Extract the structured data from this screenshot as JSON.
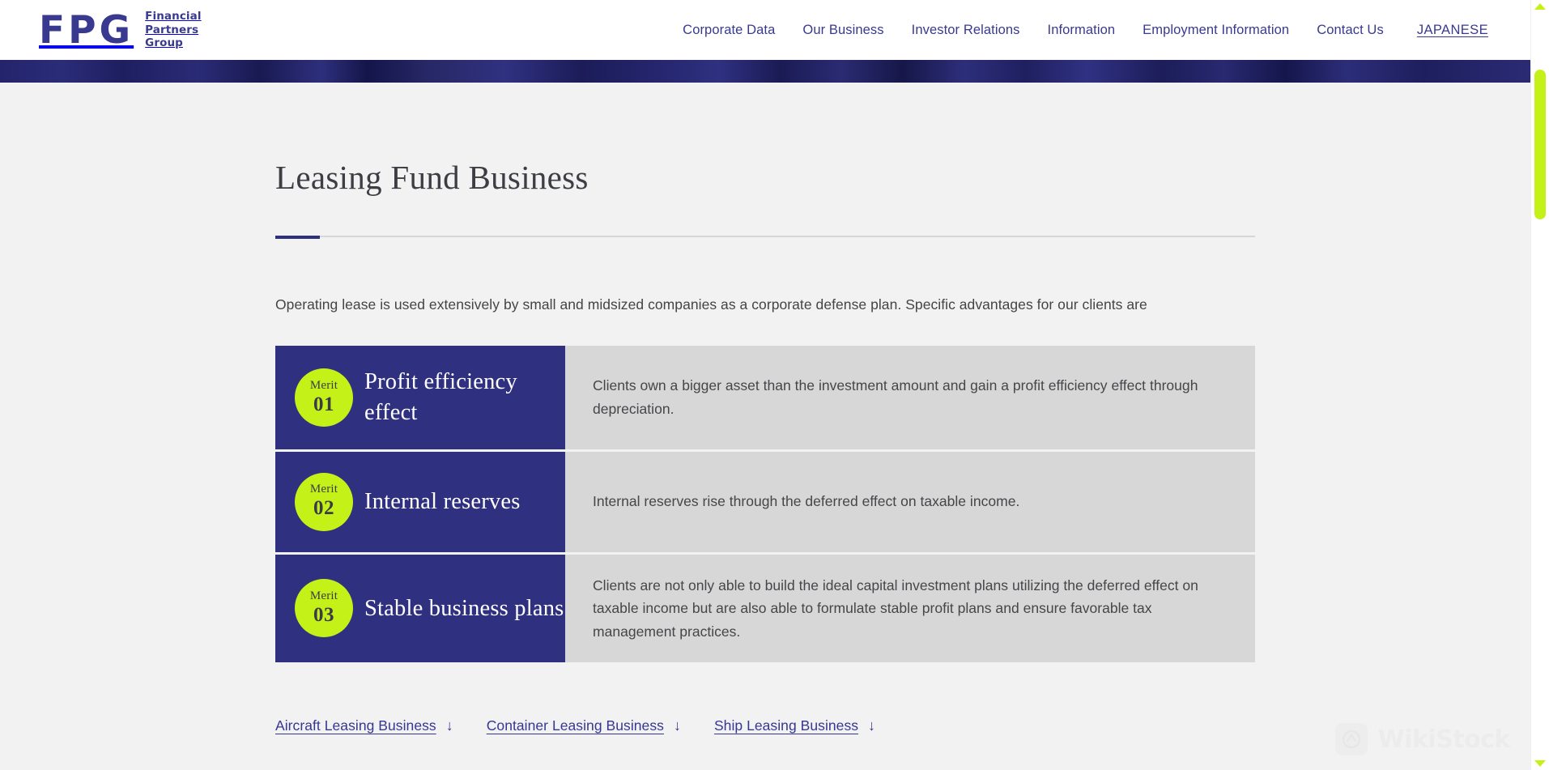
{
  "header": {
    "logo": {
      "mark": "FPG",
      "line1": "Financial",
      "line2": "Partners",
      "line3": "Group"
    },
    "nav": [
      {
        "label": "Corporate Data"
      },
      {
        "label": "Our Business"
      },
      {
        "label": "Investor Relations"
      },
      {
        "label": "Information"
      },
      {
        "label": "Employment Information"
      },
      {
        "label": "Contact Us"
      }
    ],
    "language_link": "JAPANESE"
  },
  "main": {
    "page_title": "Leasing Fund Business",
    "intro": "Operating lease is used extensively by small and midsized companies as a corporate defense plan. Specific advantages for our clients are",
    "merits": [
      {
        "badge_word": "Merit",
        "badge_number": "01",
        "title": "Profit efficiency effect",
        "description": "Clients own a bigger asset than the investment amount and gain a profit efficiency effect through depreciation."
      },
      {
        "badge_word": "Merit",
        "badge_number": "02",
        "title": "Internal reserves",
        "description": "Internal reserves rise through the deferred effect on taxable income."
      },
      {
        "badge_word": "Merit",
        "badge_number": "03",
        "title": "Stable business plans",
        "description": "Clients are not only able to build the ideal capital investment plans utilizing the deferred effect on taxable income but are also able to formulate stable profit plans and ensure favorable tax management practices."
      }
    ],
    "bottom_links": [
      {
        "label": "Aircraft Leasing Business",
        "arrow": "↓"
      },
      {
        "label": "Container Leasing Business",
        "arrow": "↓"
      },
      {
        "label": "Ship Leasing Business",
        "arrow": "↓"
      }
    ]
  },
  "watermark": {
    "text": "WikiStock"
  },
  "colors": {
    "navy": "#2f3080",
    "lime": "#c4f218",
    "panel_gray": "#d7d7d7",
    "page_bg": "#f2f2f2",
    "link_navy": "#363793"
  }
}
